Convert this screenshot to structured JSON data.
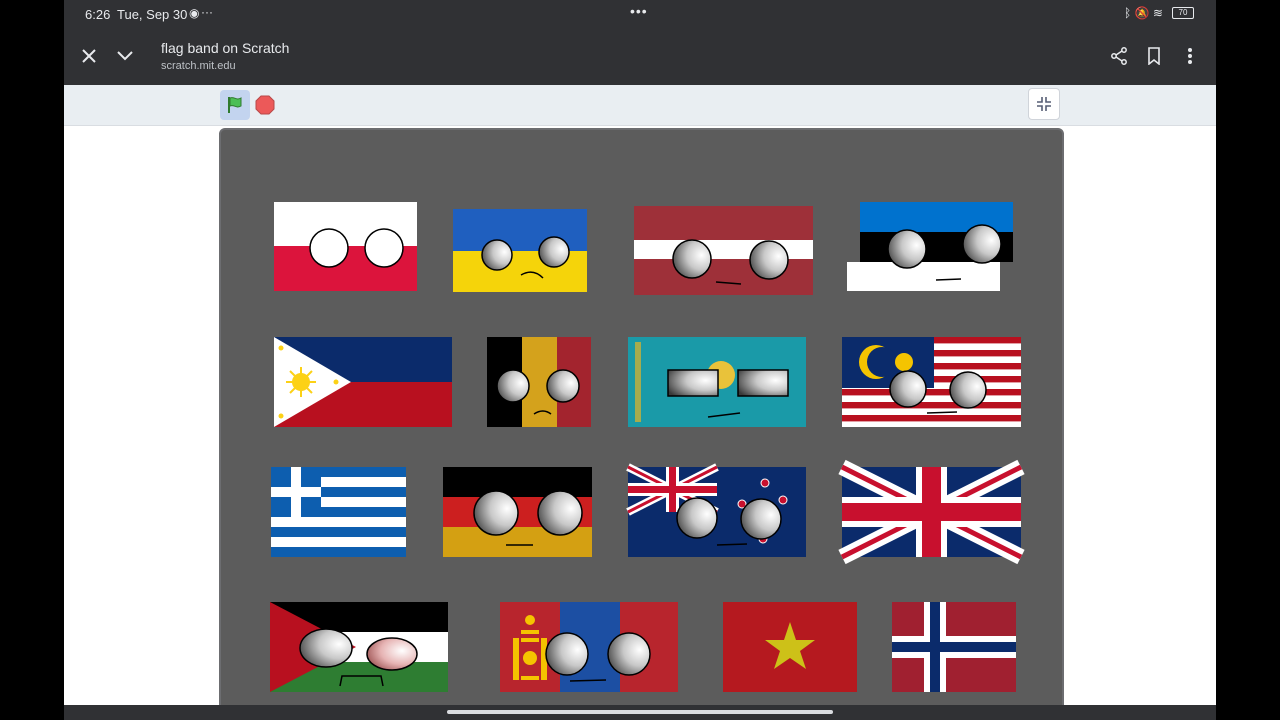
{
  "status_bar": {
    "time": "6:26",
    "date": "Tue, Sep 30",
    "more": "···",
    "center_dots": "•••",
    "battery": "70",
    "icons": [
      "bluetooth-icon",
      "dnd-off-icon",
      "wifi-icon",
      "battery-icon"
    ]
  },
  "browser": {
    "title": "flag band on Scratch",
    "url": "scratch.mit.edu",
    "close_icon": "close-icon",
    "collapse_icon": "chevron-down-icon",
    "share_icon": "share-icon",
    "bookmark_icon": "bookmark-icon",
    "menu_icon": "more-vertical-icon"
  },
  "scratch": {
    "green_flag": "green-flag-icon",
    "stop": "stop-icon",
    "fullscreen": "exit-fullscreen-icon"
  },
  "stage": {
    "flags": [
      "Poland",
      "Ukraine",
      "Latvia",
      "Estonia",
      "Philippines",
      "Belgium",
      "Kazakhstan",
      "Malaysia",
      "Greece",
      "Germany",
      "New Zealand",
      "United Kingdom",
      "Palestine",
      "Mongolia",
      "Vietnam",
      "Norway"
    ]
  },
  "colors": {
    "chrome_dark": "#303134",
    "stage_bg": "#5c5c5c",
    "scratch_bar": "#e9eef2"
  }
}
